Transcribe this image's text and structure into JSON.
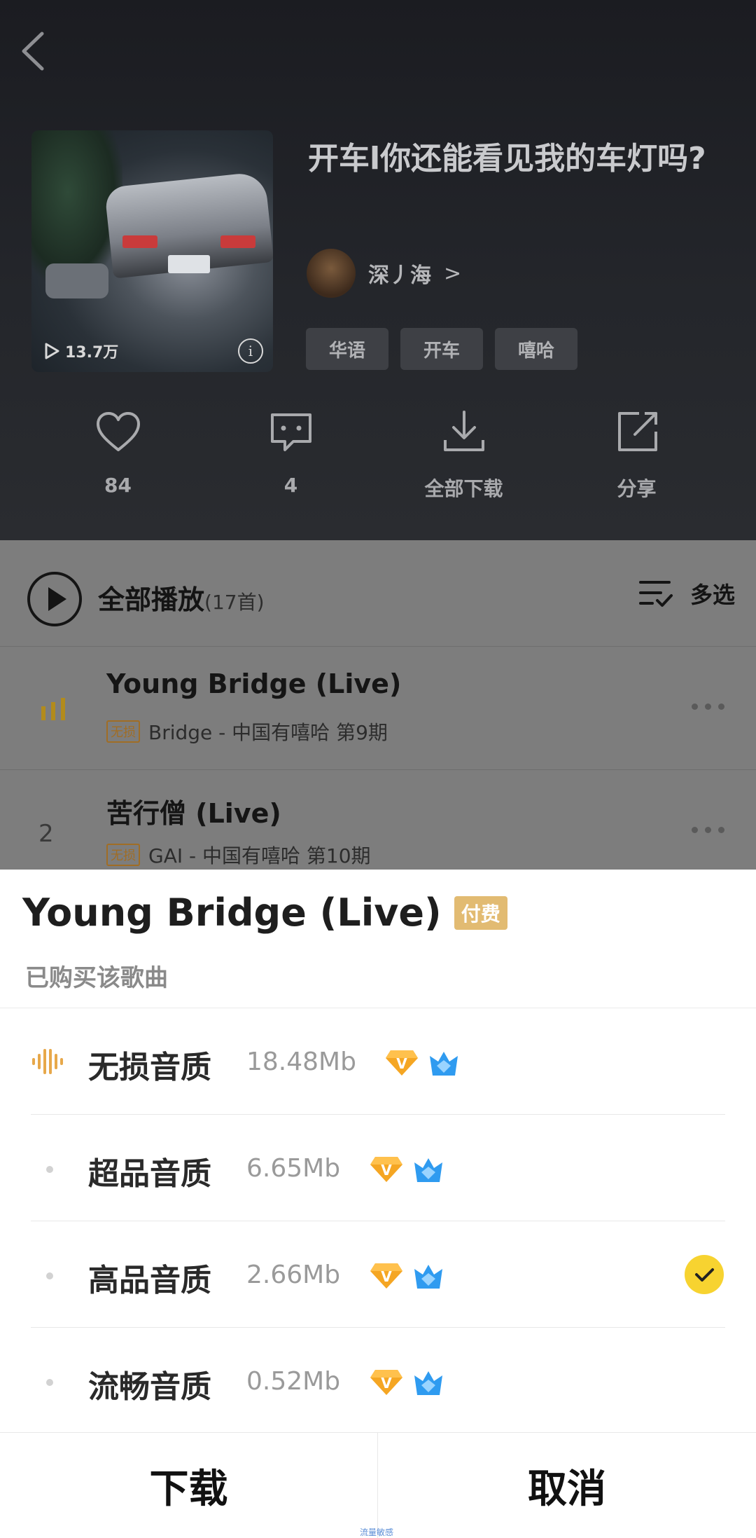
{
  "playlist": {
    "title": "开车l你还能看见我的车灯吗?",
    "play_count": "13.7万",
    "creator_name": "深丿海",
    "tags": [
      "华语",
      "开车",
      "嘻哈"
    ]
  },
  "actions": {
    "like_count": "84",
    "comment_count": "4",
    "download_label": "全部下载",
    "share_label": "分享"
  },
  "list": {
    "play_all_label": "全部播放",
    "play_all_count": "(17首)",
    "multi_select_label": "多选",
    "songs": [
      {
        "index": "",
        "title": "Young Bridge (Live)",
        "badge": "无损",
        "subtitle": "Bridge - 中国有嘻哈 第9期",
        "playing": true
      },
      {
        "index": "2",
        "title": "苦行僧 (Live)",
        "badge": "无损",
        "subtitle": "GAI - 中国有嘻哈 第10期",
        "playing": false
      }
    ]
  },
  "sheet": {
    "song_title": "Young Bridge (Live)",
    "paid_badge": "付费",
    "purchased_note": "已购买该歌曲",
    "qualities": [
      {
        "name": "无损音质",
        "size": "18.48Mb",
        "selected": false
      },
      {
        "name": "超品音质",
        "size": "6.65Mb",
        "selected": false
      },
      {
        "name": "高品音质",
        "size": "2.66Mb",
        "selected": true
      },
      {
        "name": "流畅音质",
        "size": "0.52Mb",
        "selected": false
      }
    ],
    "download_button": "下载",
    "cancel_button": "取消",
    "watermark": "流量敏感"
  },
  "colors": {
    "accent_yellow": "#f7d330",
    "gold": "#e2bb72",
    "vip_orange": "#f5a623",
    "vip_blue": "#2f9bf0"
  }
}
